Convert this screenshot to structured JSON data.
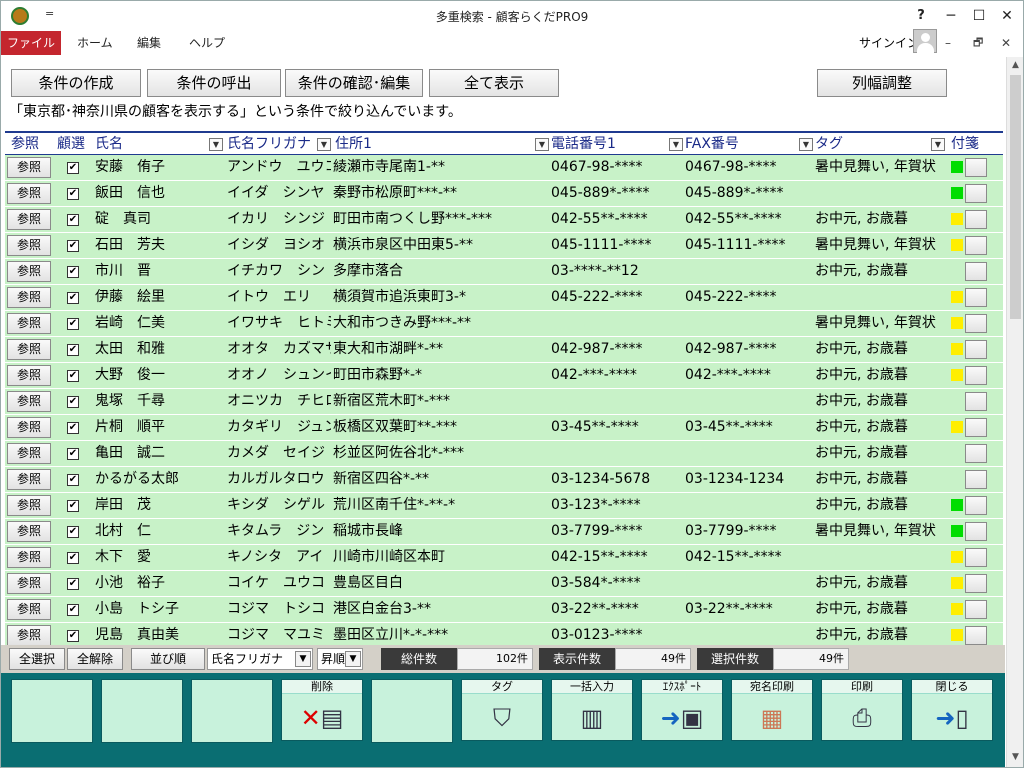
{
  "window": {
    "title": "多重検索 - 顧客らくだPRO9",
    "help": "?",
    "minimize": "─",
    "maximize": "☐",
    "close": "✕",
    "qa": "="
  },
  "menu": {
    "file": "ファイル",
    "home": "ホーム",
    "edit": "編集",
    "help": "ヘルプ",
    "signin": "サインイン",
    "ribbon_min": "–",
    "ribbon_restore": "🗗",
    "ribbon_close": "✕"
  },
  "toolbar": {
    "create": "条件の作成",
    "recall": "条件の呼出",
    "confirm": "条件の確認･編集",
    "show_all": "全て表示",
    "col_adjust": "列幅調整"
  },
  "status_text": "「東京都･神奈川県の顧客を表示する」という条件で絞り込んでいます。",
  "columns": {
    "ref": "参照",
    "select": "顧選",
    "name": "氏名",
    "kana": "氏名フリガナ",
    "address": "住所1",
    "tel": "電話番号1",
    "fax": "FAX番号",
    "tag": "タグ",
    "sticky": "付箋"
  },
  "ref_label": "参照",
  "check_mark": "✔",
  "rows": [
    {
      "name": "安藤　侑子",
      "kana": "アンドウ　ユウコ",
      "address": "綾瀬市寺尾南1-**",
      "tel": "0467-98-****",
      "fax": "0467-98-****",
      "tag": "暑中見舞い, 年賀状",
      "color": "#00dd00"
    },
    {
      "name": "飯田　信也",
      "kana": "イイダ　シンヤ",
      "address": "秦野市松原町***-**",
      "tel": "045-889*-****",
      "fax": "045-889*-****",
      "tag": "",
      "color": "#00dd00"
    },
    {
      "name": "碇　真司",
      "kana": "イカリ　シンジ",
      "address": "町田市南つくし野***-***",
      "tel": "042-55**-****",
      "fax": "042-55**-****",
      "tag": "お中元, お歳暮",
      "color": "#ffee00"
    },
    {
      "name": "石田　芳夫",
      "kana": "イシダ　ヨシオ",
      "address": "横浜市泉区中田東5-**",
      "tel": "045-1111-****",
      "fax": "045-1111-****",
      "tag": "暑中見舞い, 年賀状",
      "color": "#ffee00"
    },
    {
      "name": "市川　晋",
      "kana": "イチカワ　シン",
      "address": "多摩市落合",
      "tel": "03-****-**12",
      "fax": "",
      "tag": "お中元, お歳暮",
      "color": ""
    },
    {
      "name": "伊藤　絵里",
      "kana": "イトウ　エリ",
      "address": "横須賀市追浜東町3-*",
      "tel": "045-222-****",
      "fax": "045-222-****",
      "tag": "",
      "color": "#ffee00"
    },
    {
      "name": "岩崎　仁美",
      "kana": "イワサキ　ヒトミ",
      "address": "大和市つきみ野***-**",
      "tel": "",
      "fax": "",
      "tag": "暑中見舞い, 年賀状",
      "color": "#ffee00"
    },
    {
      "name": "太田　和雅",
      "kana": "オオタ　カズマサ",
      "address": "東大和市湖畔*-**",
      "tel": "042-987-****",
      "fax": "042-987-****",
      "tag": "お中元, お歳暮",
      "color": "#ffee00"
    },
    {
      "name": "大野　俊一",
      "kana": "オオノ　シュンイチ",
      "address": "町田市森野*-*",
      "tel": "042-***-****",
      "fax": "042-***-****",
      "tag": "お中元, お歳暮",
      "color": "#ffee00"
    },
    {
      "name": "鬼塚　千尋",
      "kana": "オニツカ　チヒロ",
      "address": "新宿区荒木町*-***",
      "tel": "",
      "fax": "",
      "tag": "お中元, お歳暮",
      "color": ""
    },
    {
      "name": "片桐　順平",
      "kana": "カタギリ　ジュンペイ",
      "address": "板橋区双葉町**-***",
      "tel": "03-45**-****",
      "fax": "03-45**-****",
      "tag": "お中元, お歳暮",
      "color": "#ffee00"
    },
    {
      "name": "亀田　誠二",
      "kana": "カメダ　セイジ",
      "address": "杉並区阿佐谷北*-***",
      "tel": "",
      "fax": "",
      "tag": "お中元, お歳暮",
      "color": ""
    },
    {
      "name": "かるがる太郎",
      "kana": "カルガルタロウ",
      "address": "新宿区四谷*-**",
      "tel": "03-1234-5678",
      "fax": "03-1234-1234",
      "tag": "お中元, お歳暮",
      "color": ""
    },
    {
      "name": "岸田　茂",
      "kana": "キシダ　シゲル",
      "address": "荒川区南千住*-**-*",
      "tel": "03-123*-****",
      "fax": "",
      "tag": "お中元, お歳暮",
      "color": "#00dd00"
    },
    {
      "name": "北村　仁",
      "kana": "キタムラ　ジン",
      "address": "稲城市長峰",
      "tel": "03-7799-****",
      "fax": "03-7799-****",
      "tag": "暑中見舞い, 年賀状",
      "color": "#00dd00"
    },
    {
      "name": "木下　愛",
      "kana": "キノシタ　アイ",
      "address": "川崎市川崎区本町",
      "tel": "042-15**-****",
      "fax": "042-15**-****",
      "tag": "",
      "color": "#ffee00"
    },
    {
      "name": "小池　裕子",
      "kana": "コイケ　ユウコ",
      "address": "豊島区目白",
      "tel": "03-584*-****",
      "fax": "",
      "tag": "お中元, お歳暮",
      "color": "#ffee00"
    },
    {
      "name": "小島　トシ子",
      "kana": "コジマ　トシコ",
      "address": "港区白金台3-**",
      "tel": "03-22**-****",
      "fax": "03-22**-****",
      "tag": "お中元, お歳暮",
      "color": "#ffee00"
    },
    {
      "name": "児島　真由美",
      "kana": "コジマ　マユミ",
      "address": "墨田区立川*-*-***",
      "tel": "03-0123-****",
      "fax": "",
      "tag": "お中元, お歳暮",
      "color": "#ffee00"
    }
  ],
  "footer": {
    "select_all": "全選択",
    "deselect_all": "全解除",
    "sort_label": "並び順",
    "sort_field": "氏名フリガナ",
    "sort_order": "昇順",
    "total_label": "総件数",
    "total_value": "102件",
    "shown_label": "表示件数",
    "shown_value": "49件",
    "selected_label": "選択件数",
    "selected_value": "49件"
  },
  "actions": {
    "delete": "削除",
    "tag": "タグ",
    "bulk": "一括入力",
    "export": "ｴｸｽﾎﾟｰﾄ",
    "address_print": "宛名印刷",
    "print": "印刷",
    "close": "閉じる"
  },
  "icons": {
    "delete": "delete-doc-icon",
    "tag": "tag-icon",
    "bulk": "bulk-edit-icon",
    "export": "export-disk-icon",
    "address_print": "address-print-icon",
    "print": "printer-icon",
    "close": "exit-door-icon"
  }
}
